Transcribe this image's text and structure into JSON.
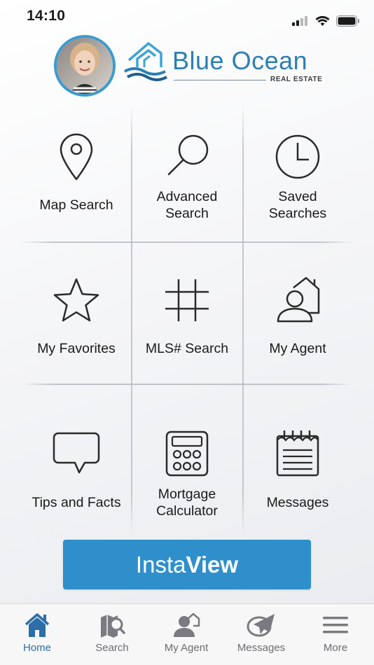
{
  "status_bar": {
    "time": "14:10"
  },
  "brand": {
    "name_part1": "Blue ",
    "name_part2": "Ocean",
    "subtitle": "REAL ESTATE",
    "accent_color": "#2b7fb4"
  },
  "menu": [
    {
      "label": "Map Search",
      "icon": "map-pin-icon"
    },
    {
      "label": "Advanced\nSearch",
      "icon": "magnifier-icon"
    },
    {
      "label": "Saved\nSearches",
      "icon": "clock-icon"
    },
    {
      "label": "My Favorites",
      "icon": "star-icon"
    },
    {
      "label": "MLS# Search",
      "icon": "hashtag-icon"
    },
    {
      "label": "My Agent",
      "icon": "agent-house-icon"
    },
    {
      "label": "Tips and Facts",
      "icon": "speech-bubble-icon"
    },
    {
      "label": "Mortgage\nCalculator",
      "icon": "calculator-icon"
    },
    {
      "label": "Messages",
      "icon": "notepad-icon"
    }
  ],
  "instaview": {
    "part1": "Insta",
    "part2": "View",
    "color": "#2f8fcb"
  },
  "tabbar": [
    {
      "label": "Home",
      "icon": "home-icon",
      "active": true
    },
    {
      "label": "Search",
      "icon": "search-map-icon",
      "active": false
    },
    {
      "label": "My Agent",
      "icon": "agent-icon",
      "active": false
    },
    {
      "label": "Messages",
      "icon": "paper-plane-icon",
      "active": false
    },
    {
      "label": "More",
      "icon": "hamburger-icon",
      "active": false
    }
  ]
}
